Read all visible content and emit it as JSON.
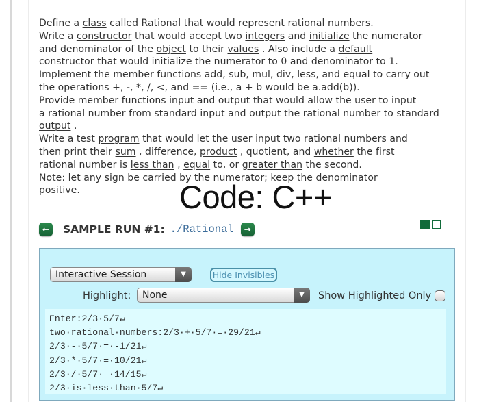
{
  "problem": {
    "lines": [
      [
        {
          "t": "Define a "
        },
        {
          "t": "class",
          "u": true
        },
        {
          "t": "  called Rational that would represent rational numbers."
        }
      ],
      [
        {
          "t": "Write a "
        },
        {
          "t": "constructor",
          "u": true
        },
        {
          "t": "  that would accept two "
        },
        {
          "t": "integers",
          "u": true
        },
        {
          "t": "  and "
        },
        {
          "t": "initialize",
          "u": true
        },
        {
          "t": "  the numerator"
        }
      ],
      [
        {
          "t": "and denominator of the "
        },
        {
          "t": "object",
          "u": true
        },
        {
          "t": "  to their "
        },
        {
          "t": "values",
          "u": true
        },
        {
          "t": " . Also include a "
        },
        {
          "t": "default",
          "u": true
        }
      ],
      [
        {
          "t": "constructor",
          "u": true
        },
        {
          "t": "  that would "
        },
        {
          "t": "initialize",
          "u": true
        },
        {
          "t": "  the numerator to 0 and denominator to 1."
        }
      ],
      [
        {
          "t": "Implement the member functions add, sub, mul, div, less, and "
        },
        {
          "t": "equal",
          "u": true
        },
        {
          "t": "  to carry out"
        }
      ],
      [
        {
          "t": "the "
        },
        {
          "t": "operations",
          "u": true
        },
        {
          "t": "  +, -, *, /, <, and == (i.e., a + b would be a.add(b))."
        }
      ],
      [
        {
          "t": "Provide member functions input and "
        },
        {
          "t": "output",
          "u": true
        },
        {
          "t": "  that would allow the user to input"
        }
      ],
      [
        {
          "t": "a rational number from standard input and "
        },
        {
          "t": "output",
          "u": true
        },
        {
          "t": "  the rational number to "
        },
        {
          "t": "standard",
          "u": true
        }
      ],
      [
        {
          "t": "output",
          "u": true
        },
        {
          "t": " ."
        }
      ],
      [
        {
          "t": "Write a test "
        },
        {
          "t": "program",
          "u": true
        },
        {
          "t": "  that would let the user input two rational numbers and"
        }
      ],
      [
        {
          "t": "then print their "
        },
        {
          "t": "sum",
          "u": true
        },
        {
          "t": " , difference, "
        },
        {
          "t": "product",
          "u": true
        },
        {
          "t": " , quotient, and "
        },
        {
          "t": "whether",
          "u": true
        },
        {
          "t": "  the first"
        }
      ],
      [
        {
          "t": "rational number is "
        },
        {
          "t": "less than",
          "u": true
        },
        {
          "t": " , "
        },
        {
          "t": "equal",
          "u": true
        },
        {
          "t": "  to, or "
        },
        {
          "t": "greater than",
          "u": true
        },
        {
          "t": "  the second."
        }
      ],
      [
        {
          "t": "Note: let any sign be carried by the numerator; keep the denominator"
        }
      ],
      [
        {
          "t": "positive."
        }
      ]
    ]
  },
  "code_label": "Code: C++",
  "sample_run": {
    "prev_icon": "←",
    "next_icon": "→",
    "title": "SAMPLE RUN #1:",
    "command": "./Rational"
  },
  "session": {
    "mode_select": {
      "value": "Interactive Session",
      "arrow": "▼"
    },
    "hide_invisibles_label": "Hide Invisibles",
    "highlight_label": "Highlight:",
    "highlight_select": {
      "value": "None",
      "arrow": "▼"
    },
    "show_highlighted_only_label": "Show Highlighted Only",
    "show_highlighted_only_checked": false,
    "output_lines": [
      "Enter:2/3·5/7↵",
      "two·rational·numbers:2/3·+·5/7·=·29/21↵",
      "2/3·-·5/7·=·-1/21↵",
      "2/3·*·5/7·=·10/21↵",
      "2/3·/·5/7·=·14/15↵",
      "2/3·is·less·than·5/7↵"
    ]
  },
  "colors": {
    "accent_green": "#116b3a",
    "session_bg": "#c7f3fc",
    "command_blue": "#3a6b99"
  }
}
